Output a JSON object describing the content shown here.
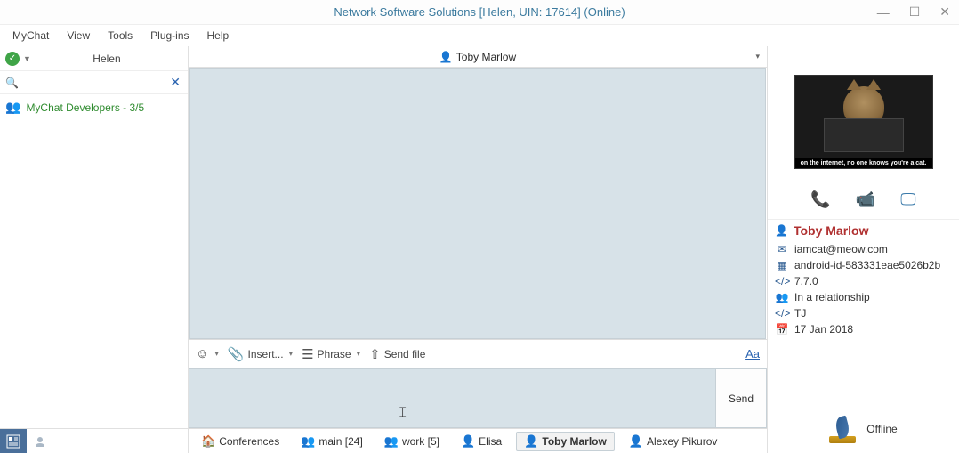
{
  "window": {
    "title": "Network Software Solutions [Helen, UIN: 17614] (Online)"
  },
  "menubar": {
    "items": [
      "MyChat",
      "View",
      "Tools",
      "Plug-ins",
      "Help"
    ]
  },
  "left": {
    "username": "Helen",
    "group_label": "MyChat Developers - 3/5"
  },
  "chat": {
    "header_name": "Toby Marlow",
    "toolbar": {
      "insert": "Insert...",
      "phrase": "Phrase",
      "sendfile": "Send file",
      "formatting": "Aa"
    },
    "send_label": "Send"
  },
  "bottom_tabs": {
    "conferences": "Conferences",
    "main": "main [24]",
    "work": "work [5]",
    "elisa": "Elisa",
    "toby": "Toby Marlow",
    "alexey": "Alexey Pikurov"
  },
  "right": {
    "meme_caption": "on the internet, no one knows you're a cat.",
    "name": "Toby Marlow",
    "email": "iamcat@meow.com",
    "device": "android-id-583331eae5026b2b",
    "version": "7.7.0",
    "relationship": "In a relationship",
    "nickname": "TJ",
    "date": "17 Jan 2018",
    "presence": "Offline"
  }
}
